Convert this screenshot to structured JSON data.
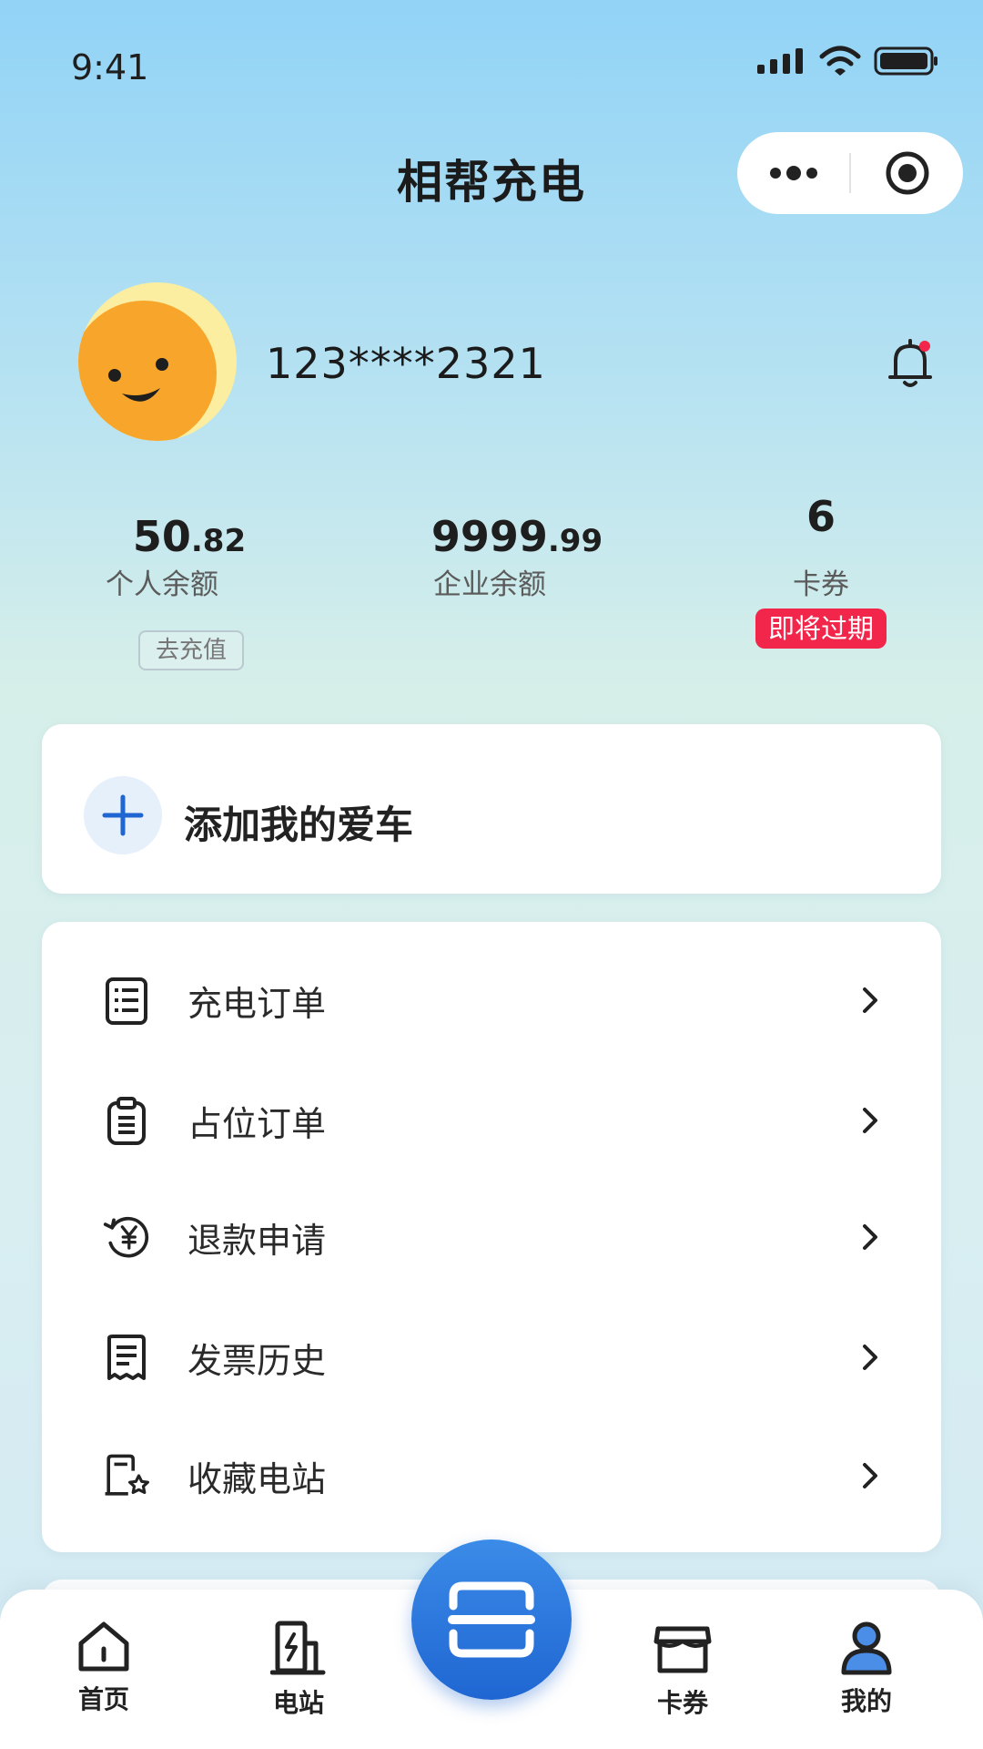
{
  "status_bar": {
    "time": "9:41"
  },
  "header": {
    "title": "相帮充电"
  },
  "profile": {
    "phone": "123****2321"
  },
  "stats": {
    "personal": {
      "int": "50",
      "dec": ".82",
      "label": "个人余额",
      "action": "去充值"
    },
    "enterprise": {
      "int": "9999",
      "dec": ".99",
      "label": "企业余额"
    },
    "coupons": {
      "count": "6",
      "label": "卡券",
      "badge": "即将过期"
    }
  },
  "add_car": {
    "label": "添加我的爱车"
  },
  "menu": [
    {
      "label": "充电订单",
      "icon": "receipt-list-icon"
    },
    {
      "label": "占位订单",
      "icon": "clipboard-icon"
    },
    {
      "label": "退款申请",
      "icon": "refund-yuan-icon"
    },
    {
      "label": "发票历史",
      "icon": "invoice-icon"
    },
    {
      "label": "收藏电站",
      "icon": "favorite-station-icon"
    }
  ],
  "tabbar": {
    "home": "首页",
    "station": "电站",
    "coupons": "卡券",
    "mine": "我的"
  },
  "colors": {
    "accent": "#1f66d2",
    "badge": "#f2254a"
  }
}
